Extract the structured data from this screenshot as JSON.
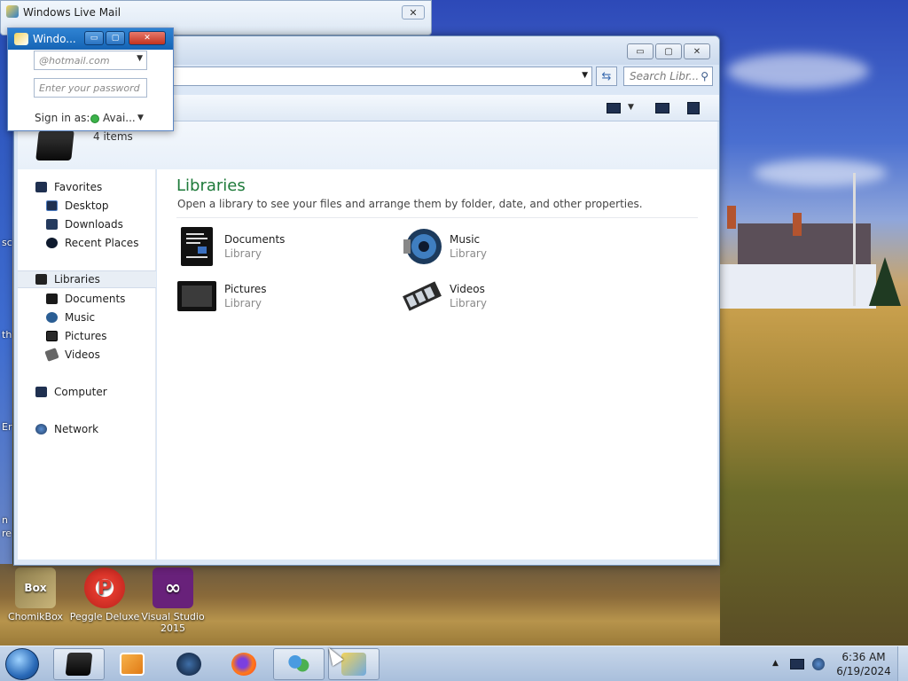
{
  "wlm_window": {
    "title": "Windows Live Mail",
    "close": "✕"
  },
  "signin_popup": {
    "title": "Windo...",
    "minimize": "▭",
    "restore": "▢",
    "close": "✕",
    "email_placeholder": "@hotmail.com",
    "password_placeholder": "Enter your password",
    "signin_as_label": "Sign in as:",
    "status_value": "Avai...",
    "status_color": "#3cb24a"
  },
  "explorer": {
    "minimize": "▭",
    "restore": "▢",
    "close": "✕",
    "search_placeholder": "Search Libr...",
    "item_count": "4 items",
    "nav": {
      "favorites": "Favorites",
      "desktop": "Desktop",
      "downloads": "Downloads",
      "recent_places": "Recent Places",
      "libraries": "Libraries",
      "documents": "Documents",
      "music": "Music",
      "pictures": "Pictures",
      "videos": "Videos",
      "computer": "Computer",
      "network": "Network"
    },
    "content": {
      "title": "Libraries",
      "description": "Open a library to see your files and arrange them by folder, date, and other properties.",
      "items": [
        {
          "name": "Documents",
          "type": "Library",
          "icon": "documents-library-icon"
        },
        {
          "name": "Music",
          "type": "Library",
          "icon": "music-library-icon"
        },
        {
          "name": "Pictures",
          "type": "Library",
          "icon": "pictures-library-icon"
        },
        {
          "name": "Videos",
          "type": "Library",
          "icon": "videos-library-icon"
        }
      ]
    }
  },
  "desktop_icons": [
    {
      "label": "ChomikBox"
    },
    {
      "label": "Peggle Deluxe"
    },
    {
      "label": "Visual Studio 2015"
    }
  ],
  "desktop_edge_text": [
    "sc",
    "th",
    "Er",
    "n",
    "re"
  ],
  "taskbar": {
    "clock_time": "6:36 AM",
    "clock_date": "6/19/2024",
    "tray_arrow": "▲",
    "pinned": [
      "file-explorer",
      "media-player",
      "globe-browser",
      "firefox",
      "people-app",
      "windows-explorer"
    ]
  },
  "colors": {
    "library_title": "#1e7a3a",
    "titlebar_accent": "#1564b5"
  }
}
